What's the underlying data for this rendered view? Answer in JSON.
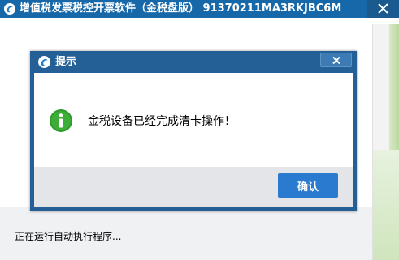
{
  "main_window": {
    "title": "增值税发票税控开票软件（金税盘版） 91370211MA3RKJBC6M",
    "status_text": "正在运行自动执行程序..."
  },
  "dialog": {
    "title": "提示",
    "message": "金税设备已经完成清卡操作！",
    "ok_label": "确认"
  },
  "colors": {
    "title_bar": "#1768a8",
    "dialog_frame": "#245f95",
    "ok_button": "#2a7ad0",
    "info_icon": "#2e9a2c"
  },
  "icons": {
    "app": "app-logo-icon",
    "close": "close-icon",
    "info": "info-icon"
  }
}
